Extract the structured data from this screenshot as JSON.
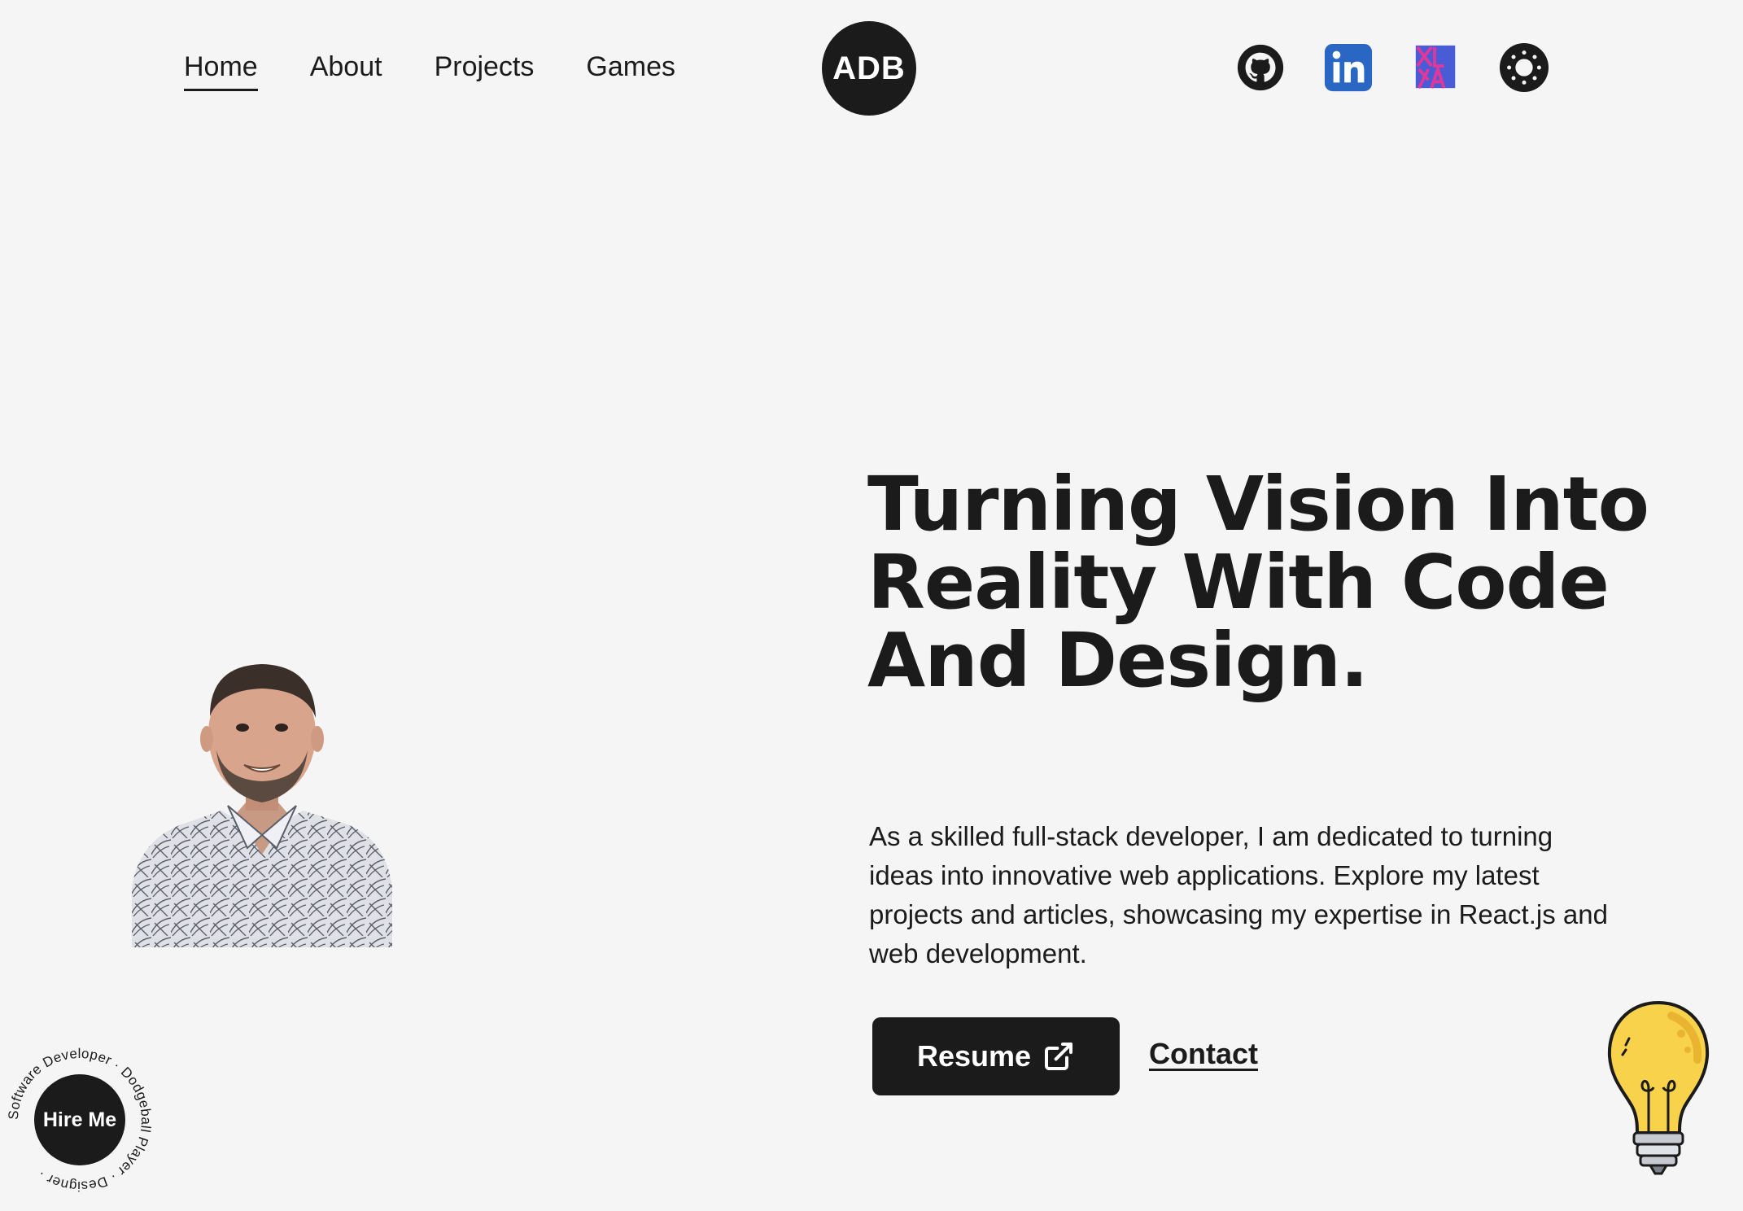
{
  "nav": {
    "items": [
      {
        "label": "Home",
        "active": true
      },
      {
        "label": "About",
        "active": false
      },
      {
        "label": "Projects",
        "active": false
      },
      {
        "label": "Games",
        "active": false
      }
    ]
  },
  "logo": {
    "text": "ADB"
  },
  "socials": [
    {
      "icon": "github-icon"
    },
    {
      "icon": "linkedin-icon",
      "text": "in",
      "color": "#2a66c4"
    },
    {
      "icon": "xlya-icon",
      "color": "#4a5bd6",
      "accent": "#e0389a"
    },
    {
      "icon": "theme-toggle-sun-icon"
    }
  ],
  "hero": {
    "headline": "Turning Vision Into Reality With Code And Design.",
    "intro": "As a skilled full-stack developer, I am dedicated to turning ideas into innovative web applications. Explore my latest projects and articles, showcasing my expertise in React.js and web development.",
    "resume_label": "Resume",
    "contact_label": "Contact"
  },
  "hire_badge": {
    "label": "Hire Me",
    "ring_text": "Software Developer · Dodgeball Player · Designer ·"
  },
  "colors": {
    "background": "#f5f5f5",
    "dark": "#1b1b1b",
    "bulb": "#f7d24a"
  }
}
